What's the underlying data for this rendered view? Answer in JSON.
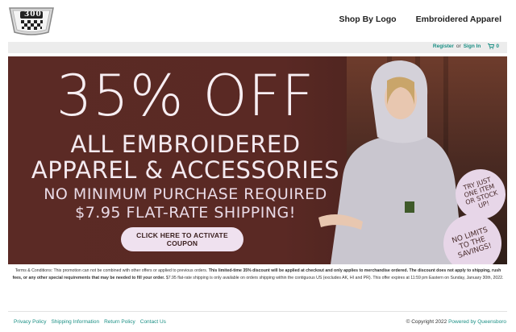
{
  "header": {
    "logo_text": "300",
    "nav": [
      {
        "label": "Shop By Logo"
      },
      {
        "label": "Embroidered Apparel"
      }
    ]
  },
  "account": {
    "register": "Register",
    "or": "or",
    "sign_in": "Sign In",
    "cart_count": "0",
    "cart_icon": "shopping-cart-icon"
  },
  "banner": {
    "headline": "35% OFF",
    "line1": "ALL EMBROIDERED",
    "line2": "APPAREL & ACCESSORIES",
    "line3": "NO MINIMUM PURCHASE REQUIRED",
    "line4": "$7.95 FLAT-RATE SHIPPING!",
    "coupon_button": "CLICK HERE TO ACTIVATE COUPON",
    "badge1": "TRY JUST ONE ITEM OR STOCK UP!",
    "badge2": "NO LIMITS TO THE SAVINGS!",
    "bg_color": "#5b2a25"
  },
  "terms": {
    "part1": "Terms & Conditions: This promotion can not be combined with other offers or applied to previous orders. ",
    "bold": "This limited-time 35% discount will be applied at checkout and only applies to merchandise ordered. The discount does not apply to shipping, rush fees, or any other special requirements that may be needed to fill your order.",
    "part2": " $7.95 flat-rate shipping is only available on orders shipping within the contiguous US (excludes AK, HI and PR). This offer expires at 11:59 pm Eastern on Sunday, January 30th, 2022."
  },
  "footer": {
    "links": [
      "Privacy Policy",
      "Shipping Information",
      "Return Policy",
      "Contact Us"
    ],
    "copyright": "© Copyright 2022",
    "powered_by": "Powered by Queensboro"
  },
  "colors": {
    "accent": "#1a8f84",
    "banner_text": "#f7eef2",
    "badge": "#e7d6e8"
  }
}
